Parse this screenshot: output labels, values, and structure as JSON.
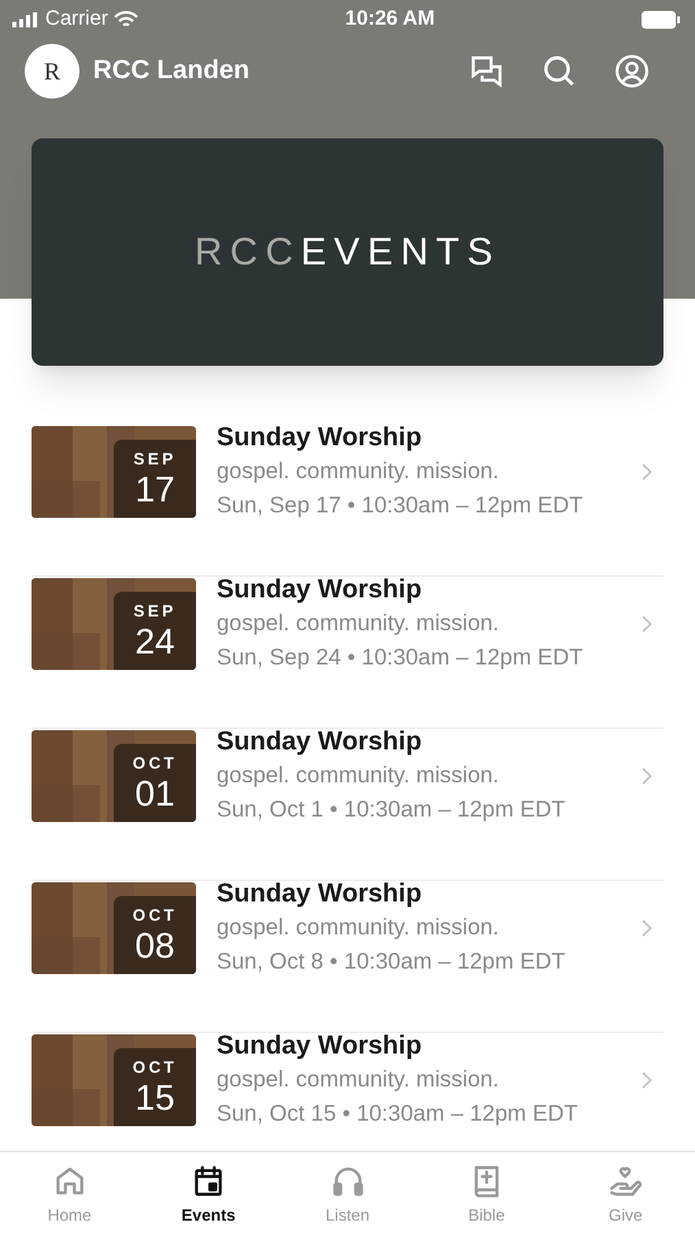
{
  "status_bar": {
    "carrier": "Carrier",
    "time": "10:26 AM"
  },
  "header": {
    "logo": "R",
    "title": "RCC Landen"
  },
  "banner": {
    "prefix": "RCC",
    "word": "EVENTS"
  },
  "events": [
    {
      "month": "SEP",
      "day": "17",
      "title": "Sunday Worship",
      "subtitle": "gospel. community. mission.",
      "when": "Sun, Sep 17 • 10:30am – 12pm EDT"
    },
    {
      "month": "SEP",
      "day": "24",
      "title": "Sunday Worship",
      "subtitle": "gospel. community. mission.",
      "when": "Sun, Sep 24 • 10:30am – 12pm EDT"
    },
    {
      "month": "OCT",
      "day": "01",
      "title": "Sunday Worship",
      "subtitle": "gospel. community. mission.",
      "when": "Sun, Oct 1 • 10:30am – 12pm EDT"
    },
    {
      "month": "OCT",
      "day": "08",
      "title": "Sunday Worship",
      "subtitle": "gospel. community. mission.",
      "when": "Sun, Oct 8 • 10:30am – 12pm EDT"
    },
    {
      "month": "OCT",
      "day": "15",
      "title": "Sunday Worship",
      "subtitle": "gospel. community. mission.",
      "when": "Sun, Oct 15 • 10:30am – 12pm EDT"
    }
  ],
  "tab_bar": [
    {
      "kind": "home",
      "label": "Home",
      "selected": false
    },
    {
      "kind": "events",
      "label": "Events",
      "selected": true
    },
    {
      "kind": "listen",
      "label": "Listen",
      "selected": false
    },
    {
      "kind": "bible",
      "label": "Bible",
      "selected": false
    },
    {
      "kind": "give",
      "label": "Give",
      "selected": false
    }
  ]
}
